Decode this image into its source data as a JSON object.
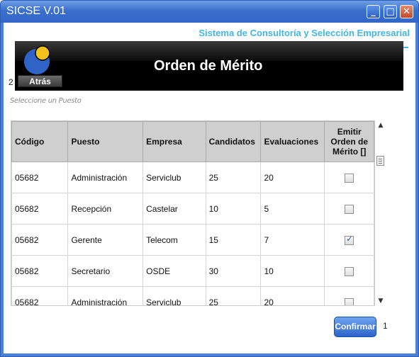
{
  "window": {
    "title": "SICSE V.01",
    "controls": {
      "minimize": "_",
      "maximize": "□",
      "close": "✕"
    }
  },
  "header": {
    "subtitle": "Sistema de Consultoría y Selección Empresarial",
    "banner_title": "Orden de Mérito",
    "back_label": "Atrás",
    "left_number": "2"
  },
  "hint": "Seleccione un Puesto",
  "table": {
    "columns": [
      "Código",
      "Puesto",
      "Empresa",
      "Candidatos",
      "Evaluaciones",
      "Emitir Orden de Mérito []"
    ],
    "rows": [
      {
        "codigo": "05682",
        "puesto": "Administración",
        "empresa": "Serviclub",
        "candidatos": "25",
        "evaluaciones": "20",
        "checked": false
      },
      {
        "codigo": "05682",
        "puesto": "Recepción",
        "empresa": "Castelar",
        "candidatos": "10",
        "evaluaciones": "5",
        "checked": false
      },
      {
        "codigo": "05682",
        "puesto": "Gerente",
        "empresa": "Telecom",
        "candidatos": "15",
        "evaluaciones": "7",
        "checked": true
      },
      {
        "codigo": "05682",
        "puesto": "Secretario",
        "empresa": "OSDE",
        "candidatos": "30",
        "evaluaciones": "10",
        "checked": false
      },
      {
        "codigo": "05682",
        "puesto": "Administración",
        "empresa": "Serviclub",
        "candidatos": "25",
        "evaluaciones": "20",
        "checked": false
      }
    ]
  },
  "scrollbar": {
    "up": "▲",
    "down": "▼"
  },
  "footer": {
    "confirm_label": "Confirmar",
    "right_number": "1"
  },
  "colors": {
    "accent": "#45b6dd",
    "titlebar": "#3a6fcb",
    "logo_blue": "#2f63c6",
    "logo_yellow": "#f3c11c"
  },
  "icons": {
    "logo": "circle-logo-icon",
    "checkbox": "checkbox-icon"
  }
}
